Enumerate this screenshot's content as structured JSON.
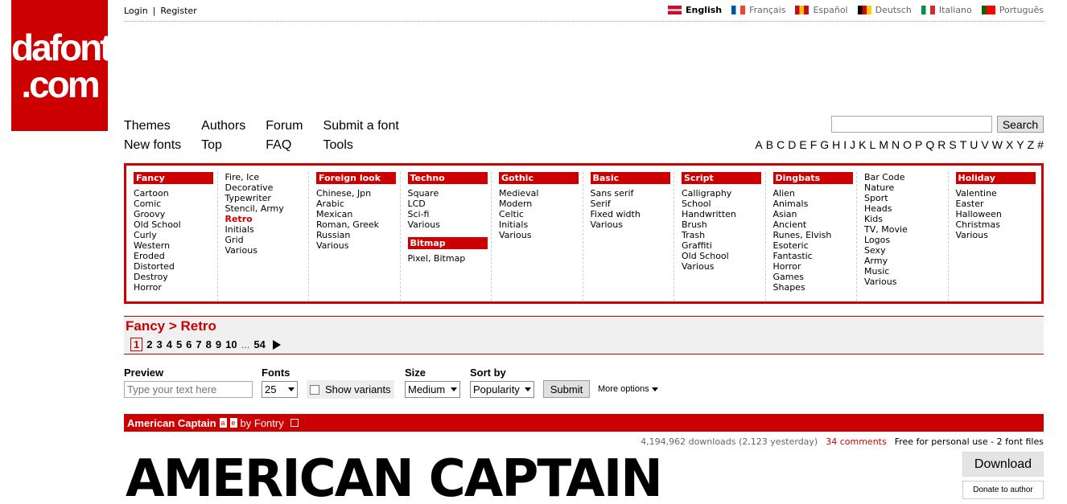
{
  "logo": {
    "line1": "dafont",
    "line2": ".com"
  },
  "toplinks": {
    "login": "Login",
    "sep": "|",
    "register": "Register"
  },
  "languages": [
    {
      "name": "English",
      "active": true,
      "flag_colors": [
        "#012169",
        "#c8102e",
        "#ffffff"
      ]
    },
    {
      "name": "Français",
      "active": false,
      "flag_colors": [
        "#0055a4",
        "#ffffff",
        "#ef4135"
      ]
    },
    {
      "name": "Español",
      "active": false,
      "flag_colors": [
        "#c60b1e",
        "#ffc400",
        "#c60b1e"
      ]
    },
    {
      "name": "Deutsch",
      "active": false,
      "flag_colors": [
        "#000000",
        "#dd0000",
        "#ffce00"
      ]
    },
    {
      "name": "Italiano",
      "active": false,
      "flag_colors": [
        "#009246",
        "#ffffff",
        "#ce2b37"
      ]
    },
    {
      "name": "Português",
      "active": false,
      "flag_colors": [
        "#006600",
        "#ff0000",
        "#ff0000"
      ]
    }
  ],
  "nav": {
    "row1": [
      "Themes",
      "Authors",
      "Forum",
      "Submit a font"
    ],
    "row2": [
      "New fonts",
      "Top",
      "FAQ",
      "Tools"
    ]
  },
  "search": {
    "placeholder": "",
    "button": "Search"
  },
  "alphabet": [
    "A",
    "B",
    "C",
    "D",
    "E",
    "F",
    "G",
    "H",
    "I",
    "J",
    "K",
    "L",
    "M",
    "N",
    "O",
    "P",
    "Q",
    "R",
    "S",
    "T",
    "U",
    "V",
    "W",
    "X",
    "Y",
    "Z",
    "#"
  ],
  "categories": [
    {
      "head": "Fancy",
      "items": [
        "Cartoon",
        "Comic",
        "Groovy",
        "Old School",
        "Curly",
        "Western",
        "Eroded",
        "Distorted",
        "Destroy",
        "Horror"
      ]
    },
    {
      "head": "",
      "items": [
        "Fire, Ice",
        "Decorative",
        "Typewriter",
        "Stencil, Army",
        "Retro",
        "Initials",
        "Grid",
        "Various"
      ],
      "selected": "Retro"
    },
    {
      "head": "Foreign look",
      "items": [
        "Chinese, Jpn",
        "Arabic",
        "Mexican",
        "Roman, Greek",
        "Russian",
        "Various"
      ]
    },
    {
      "head": "Techno",
      "items": [
        "Square",
        "LCD",
        "Sci-fi",
        "Various"
      ],
      "sub_head": "Bitmap",
      "sub_items": [
        "Pixel, Bitmap"
      ]
    },
    {
      "head": "Gothic",
      "items": [
        "Medieval",
        "Modern",
        "Celtic",
        "Initials",
        "Various"
      ]
    },
    {
      "head": "Basic",
      "items": [
        "Sans serif",
        "Serif",
        "Fixed width",
        "Various"
      ]
    },
    {
      "head": "Script",
      "items": [
        "Calligraphy",
        "School",
        "Handwritten",
        "Brush",
        "Trash",
        "Graffiti",
        "Old School",
        "Various"
      ]
    },
    {
      "head": "Dingbats",
      "items": [
        "Alien",
        "Animals",
        "Asian",
        "Ancient",
        "Runes, Elvish",
        "Esoteric",
        "Fantastic",
        "Horror",
        "Games",
        "Shapes"
      ]
    },
    {
      "head": "",
      "items": [
        "Bar Code",
        "Nature",
        "Sport",
        "Heads",
        "Kids",
        "TV, Movie",
        "Logos",
        "Sexy",
        "Army",
        "Music",
        "Various"
      ]
    },
    {
      "head": "Holiday",
      "items": [
        "Valentine",
        "Easter",
        "Halloween",
        "Christmas",
        "Various"
      ]
    }
  ],
  "breadcrumb": "Fancy > Retro",
  "pager": {
    "current": "1",
    "pages": [
      "2",
      "3",
      "4",
      "5",
      "6",
      "7",
      "8",
      "9",
      "10"
    ],
    "ellipsis": "...",
    "last": "54"
  },
  "filters": {
    "preview_label": "Preview",
    "preview_placeholder": "Type your text here",
    "fonts_label": "Fonts",
    "fonts_value": "25",
    "variants_label": "Show variants",
    "size_label": "Size",
    "size_value": "Medium",
    "sort_label": "Sort by",
    "sort_value": "Popularity",
    "submit": "Submit",
    "more_options": "More options"
  },
  "font": {
    "name": "American Captain",
    "badges": [
      "a",
      "e"
    ],
    "by": "by Fontry",
    "downloads": "4,194,962 downloads (2,123 yesterday)",
    "comments": "34 comments",
    "license": "Free for personal use - 2 font files",
    "preview": "AMERICAN CAPTAIN",
    "download_btn": "Download",
    "donate_btn": "Donate to author"
  },
  "colors": {
    "brand": "#cc0000"
  }
}
